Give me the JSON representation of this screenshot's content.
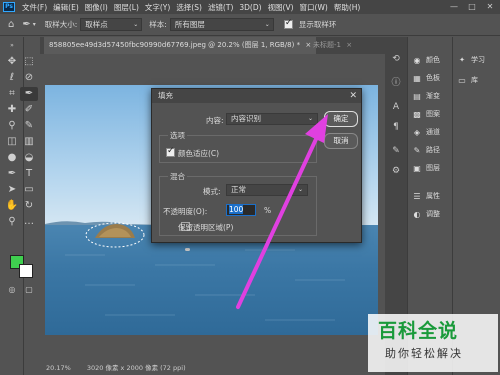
{
  "menubar": {
    "logo": "Ps",
    "items": [
      "文件(F)",
      "编辑(E)",
      "图像(I)",
      "图层(L)",
      "文字(Y)",
      "选择(S)",
      "滤镜(T)",
      "3D(D)",
      "视图(V)",
      "窗口(W)",
      "帮助(H)"
    ],
    "minimize": "—",
    "maximize": "□",
    "close": "✕"
  },
  "optbar": {
    "sample_size_label": "取样大小:",
    "sample_size_value": "取样点",
    "sample_label": "样本:",
    "sample_value": "所有图层",
    "show_ring_label": "显示取样环"
  },
  "tabs": [
    {
      "label": "858805ee49d3d57450fbc90990d67769.jpeg @ 20.2% (图层 1, RGB/8) *",
      "close": "×"
    },
    {
      "label": "未标题-1",
      "close": "×"
    }
  ],
  "status": {
    "zoom": "20.17%",
    "doc_info": "3020 像素 x 2000 像素 (72 ppi)"
  },
  "colors": {
    "foreground": "#3fcf4f",
    "background": "#ffffff",
    "arrow": "#e040e0",
    "watermark_green": "#1a9a3a"
  },
  "panels": [
    {
      "icon": "palette-icon",
      "glyph": "◉",
      "label": "颜色"
    },
    {
      "icon": "swatches-icon",
      "glyph": "▦",
      "label": "色板"
    },
    {
      "icon": "gradient-icon",
      "glyph": "▤",
      "label": "渐变"
    },
    {
      "icon": "pattern-icon",
      "glyph": "▩",
      "label": "图案"
    },
    {
      "icon": "channels-icon",
      "glyph": "◈",
      "label": "通道"
    },
    {
      "icon": "paths-icon",
      "glyph": "✎",
      "label": "路径"
    },
    {
      "icon": "layers-icon",
      "glyph": "▣",
      "label": "图层"
    },
    {
      "icon": "properties-icon",
      "glyph": "☰",
      "label": "属性"
    },
    {
      "icon": "adjustments-icon",
      "glyph": "◐",
      "label": "调整"
    }
  ],
  "learn": [
    {
      "icon": "learn-icon",
      "glyph": "💡",
      "label": "学习"
    },
    {
      "icon": "libraries-icon",
      "glyph": "▭",
      "label": "库"
    }
  ],
  "dialog": {
    "title": "填充",
    "close": "✕",
    "content_label": "内容:",
    "content_value": "内容识别",
    "ok_button": "确定",
    "cancel_button": "取消",
    "options_section": "选项",
    "color_adapt_label": "颜色适应(C)",
    "color_adapt_checked": true,
    "blending_section": "混合",
    "mode_label": "模式:",
    "mode_value": "正常",
    "opacity_label": "不透明度(O):",
    "opacity_value": "100",
    "opacity_unit": "%",
    "preserve_transparency_label": "保留透明区域(P)",
    "preserve_transparency_checked": false
  },
  "watermark": {
    "title": "百科全说",
    "subtitle": "助你轻松解决"
  }
}
